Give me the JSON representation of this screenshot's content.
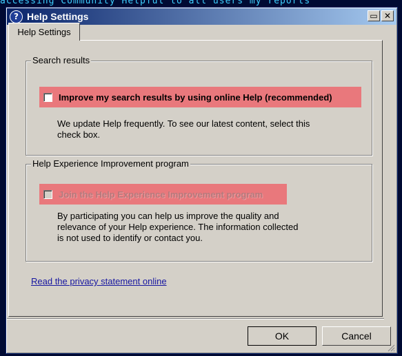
{
  "window": {
    "title": "Help Settings",
    "buttons": [
      "restore-icon",
      "close-icon"
    ]
  },
  "tabs": [
    {
      "label": "Help Settings",
      "selected": true
    }
  ],
  "search_results": {
    "legend": "Search results",
    "checkbox_label": "Improve my search results by using online Help (recommended)",
    "checked": false,
    "enabled": true,
    "description": "We update Help frequently. To see our latest content, select this\ncheck box."
  },
  "improvement_program": {
    "legend": "Help Experience Improvement program",
    "checkbox_label": "Join the Help Experience Improvement program",
    "checked": false,
    "enabled": false,
    "description": "By participating you can help us improve the quality and\nrelevance of your Help experience. The information collected\nis not used to identify or contact you."
  },
  "privacy_link": "Read the privacy statement online",
  "footer": {
    "ok_label": "OK",
    "cancel_label": "Cancel"
  },
  "colors": {
    "highlight": "#e9787c",
    "titlebar_start": "#0a246a",
    "titlebar_end": "#a6caf0",
    "dialog_face": "#d4d0c8",
    "link": "#1515a0"
  },
  "background_text": "accessing Community Helpful to all users my reports"
}
